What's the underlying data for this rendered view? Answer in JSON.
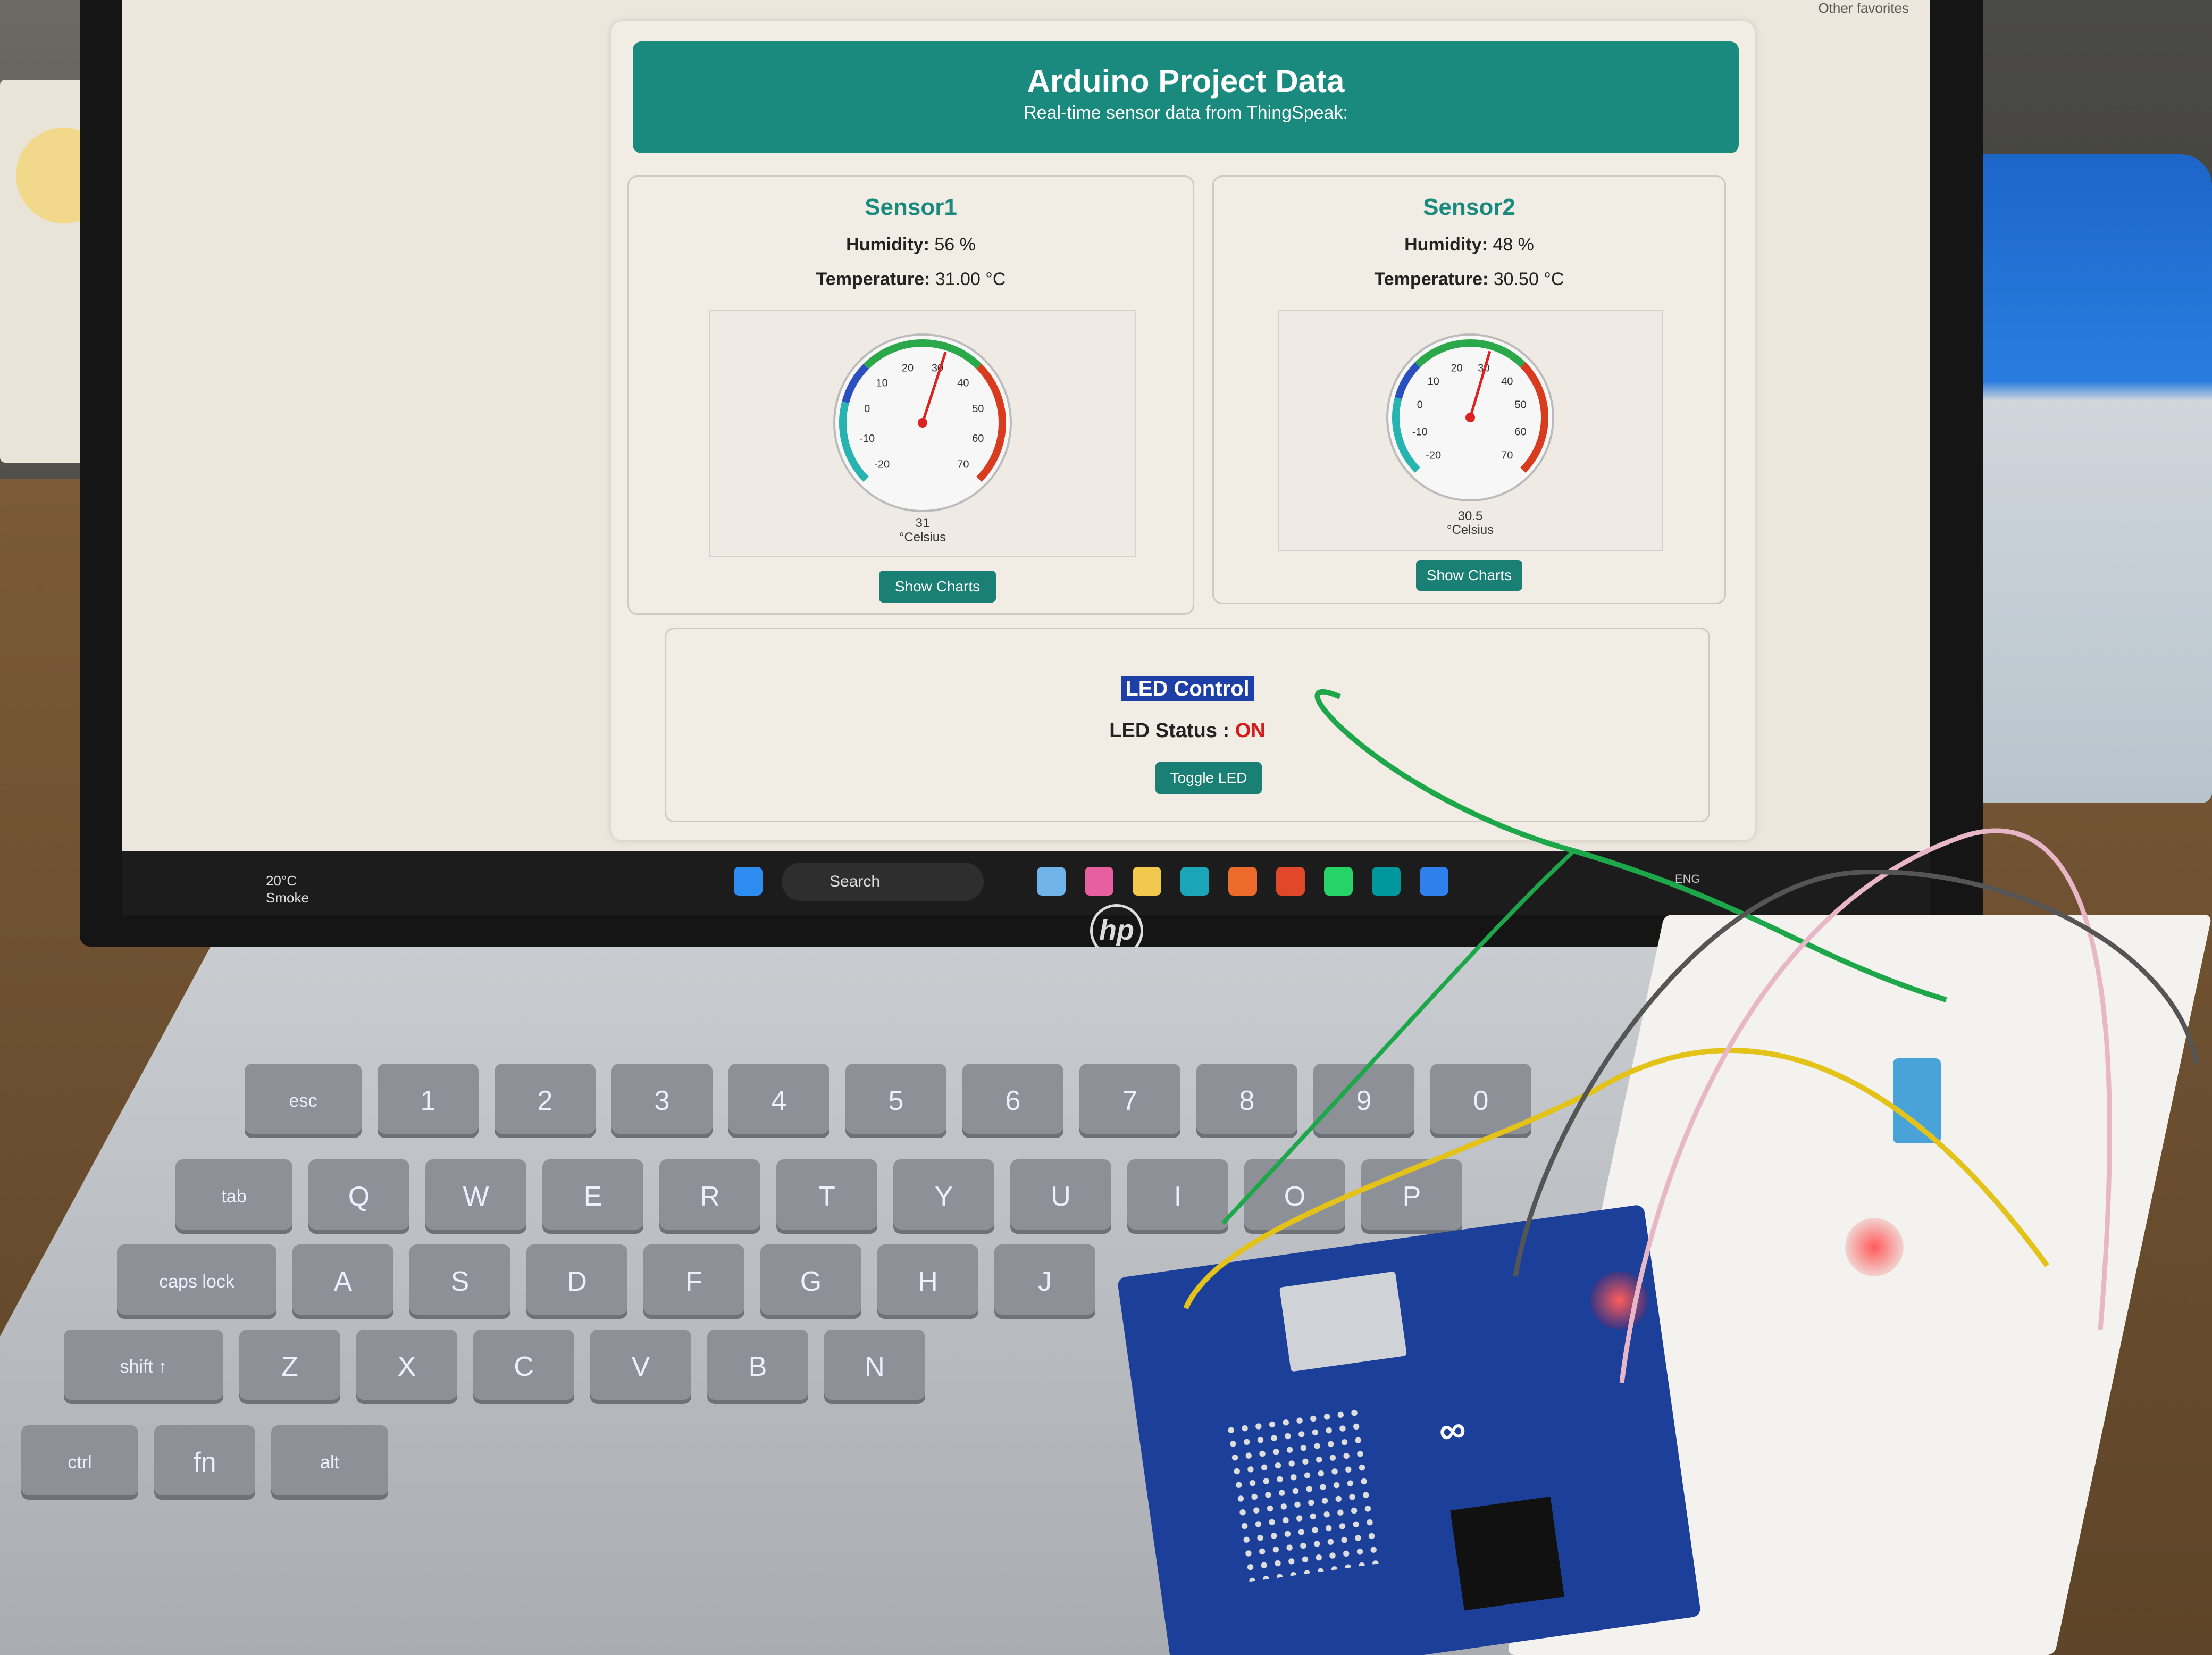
{
  "page": {
    "title": "Arduino Project Data",
    "subtitle": "Real-time sensor data from ThingSpeak:"
  },
  "sensors": [
    {
      "name": "Sensor1",
      "humidity_label": "Humidity:",
      "humidity_value": "56 %",
      "temperature_label": "Temperature:",
      "temperature_value": "31.00 °C",
      "gauge_reading": "31",
      "gauge_unit": "°Celsius",
      "gauge_value": 31,
      "button_label": "Show Charts"
    },
    {
      "name": "Sensor2",
      "humidity_label": "Humidity:",
      "humidity_value": "48 %",
      "temperature_label": "Temperature:",
      "temperature_value": "30.50 °C",
      "gauge_reading": "30.5",
      "gauge_unit": "°Celsius",
      "gauge_value": 30.5,
      "button_label": "Show Charts"
    }
  ],
  "gauge": {
    "min": -20,
    "max": 70,
    "ticks": [
      "-20",
      "-10",
      "0",
      "10",
      "20",
      "30",
      "40",
      "50",
      "60",
      "70"
    ]
  },
  "led": {
    "title": "LED Control",
    "status_label": "LED Status :",
    "status_value": "ON",
    "button_label": "Toggle LED"
  },
  "taskbar": {
    "weather_temp": "20°C",
    "weather_desc": "Smoke",
    "search_placeholder": "Search",
    "favorites": "Other favorites",
    "language": "ENG"
  },
  "laptop": {
    "brand": "hp"
  },
  "keyboard": {
    "rows": [
      [
        "esc",
        "1",
        "2",
        "3",
        "4",
        "5",
        "6",
        "7",
        "8",
        "9",
        "0"
      ],
      [
        "tab",
        "Q",
        "W",
        "E",
        "R",
        "T",
        "Y",
        "U",
        "I",
        "O",
        "P"
      ],
      [
        "caps lock",
        "A",
        "S",
        "D",
        "F",
        "G",
        "H",
        "J"
      ],
      [
        "shift ↑",
        "Z",
        "X",
        "C",
        "V",
        "B",
        "N"
      ],
      [
        "ctrl",
        "fn",
        "alt"
      ]
    ]
  },
  "colors": {
    "accent": "#1a8a7e",
    "led_on": "#d61a1a",
    "selection": "#1f3fa8"
  }
}
